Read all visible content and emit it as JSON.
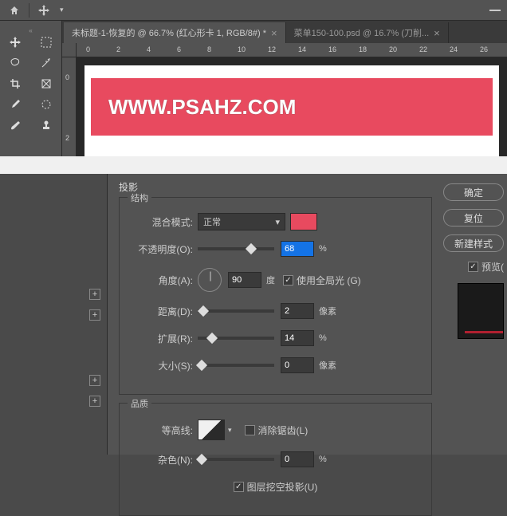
{
  "toolbar": {
    "home_icon": "home",
    "move_icon": "move"
  },
  "tabs": [
    {
      "title": "未标题-1-恢复的 @ 66.7% (红心形卡 1, RGB/8#) *",
      "active": true
    },
    {
      "title": "菜单150-100.psd @ 16.7% (刀削...",
      "active": false
    }
  ],
  "ruler_h": [
    "0",
    "2",
    "4",
    "6",
    "8",
    "10",
    "12",
    "14",
    "16",
    "18",
    "20",
    "22",
    "24",
    "26"
  ],
  "ruler_v": [
    "0",
    "2"
  ],
  "canvas": {
    "banner_text": "WWW.PSAHZ.COM"
  },
  "dialog": {
    "title": "投影",
    "structure_label": "结构",
    "quality_label": "品质",
    "blend_mode_label": "混合模式:",
    "blend_mode_value": "正常",
    "blend_color": "#e84a5f",
    "opacity_label": "不透明度(O):",
    "opacity_value": "68",
    "opacity_unit": "%",
    "angle_label": "角度(A):",
    "angle_value": "90",
    "angle_unit": "度",
    "global_light_label": "使用全局光 (G)",
    "global_light_checked": true,
    "distance_label": "距离(D):",
    "distance_value": "2",
    "distance_unit": "像素",
    "spread_label": "扩展(R):",
    "spread_value": "14",
    "spread_unit": "%",
    "size_label": "大小(S):",
    "size_value": "0",
    "size_unit": "像素",
    "contour_label": "等高线:",
    "antialias_label": "消除锯齿(L)",
    "antialias_checked": false,
    "noise_label": "杂色(N):",
    "noise_value": "0",
    "noise_unit": "%",
    "knockout_label": "图层挖空投影(U)",
    "knockout_checked": true
  },
  "buttons": {
    "ok": "确定",
    "cancel": "复位",
    "new_style": "新建样式",
    "preview": "预览("
  }
}
